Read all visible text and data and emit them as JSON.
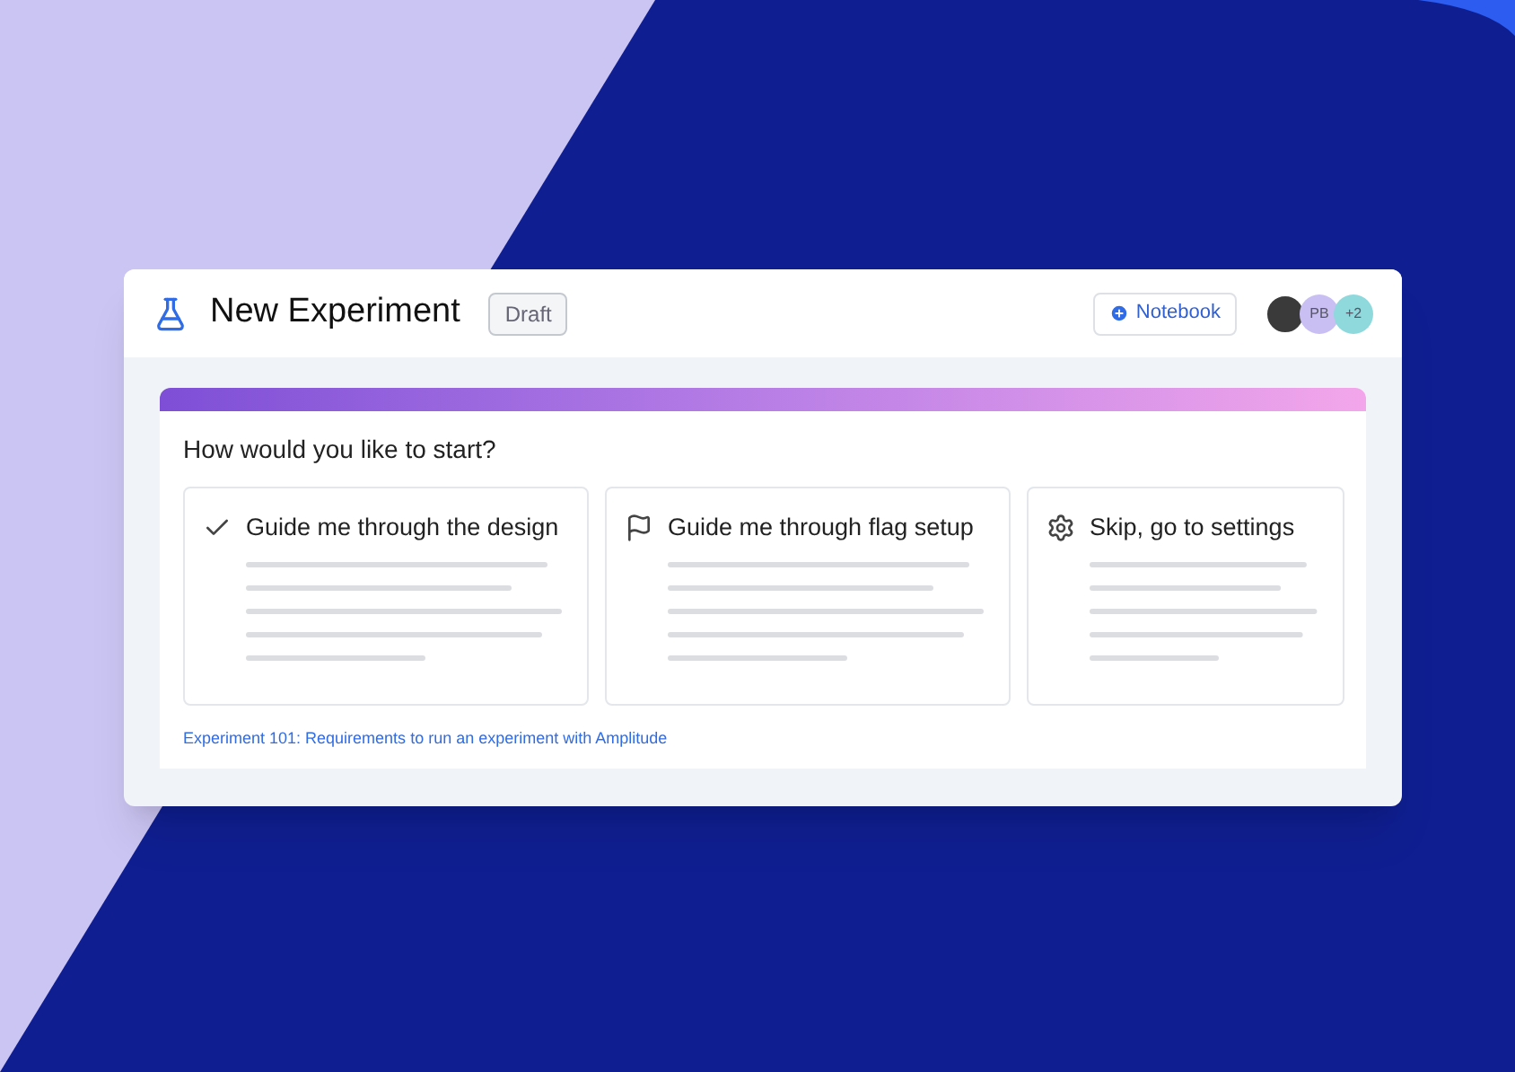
{
  "header": {
    "title": "New Experiment",
    "status": "Draft",
    "notebook_button": "Notebook",
    "avatars": [
      {
        "kind": "photo"
      },
      {
        "kind": "initials",
        "text": "PB",
        "color": "#c9bff2"
      },
      {
        "kind": "initials",
        "text": "+2",
        "color": "#8fd9dd"
      }
    ]
  },
  "prompt": "How would you like to start?",
  "options": [
    {
      "kind": "check",
      "label": "Guide me through the design"
    },
    {
      "kind": "flag",
      "label": "Guide me through flag setup"
    },
    {
      "kind": "gear",
      "label": "Skip, go to settings"
    }
  ],
  "link": "Experiment 101: Requirements to run an experiment with Amplitude"
}
